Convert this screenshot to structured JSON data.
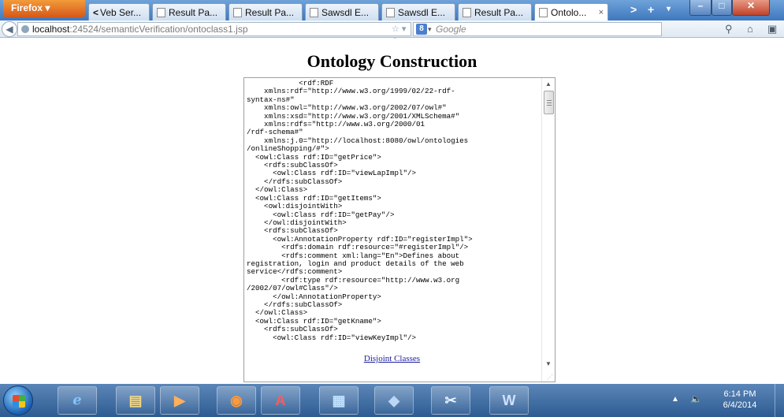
{
  "browser": {
    "menu_button": "Firefox ▾",
    "tabs": [
      {
        "label": "Veb Ser..."
      },
      {
        "label": "Result Pa..."
      },
      {
        "label": "Result Pa..."
      },
      {
        "label": "Sawsdl E..."
      },
      {
        "label": "Sawsdl E..."
      },
      {
        "label": "Result Pa..."
      },
      {
        "label": "Ontolo...",
        "active": true
      }
    ],
    "active_tab_close": "×",
    "new_tab": "+",
    "tab_scroll": ">",
    "tab_list": "▾",
    "url": {
      "host": "localhost",
      "rest": ":24524/semanticVerification/ontoclass1.jsp"
    },
    "search_placeholder": "Google",
    "search_engine_icon": "google-icon"
  },
  "page": {
    "title": "Ontology Construction",
    "textarea_content": "            <rdf:RDF\n    xmlns:rdf=\"http://www.w3.org/1999/02/22-rdf-\nsyntax-ns#\"\n    xmlns:owl=\"http://www.w3.org/2002/07/owl#\"\n    xmlns:xsd=\"http://www.w3.org/2001/XMLSchema#\"\n    xmlns:rdfs=\"http://www.w3.org/2000/01\n/rdf-schema#\"\n    xmlns:j.0=\"http://localhost:8080/owl/ontologies\n/onlineShopping/#\">\n  <owl:Class rdf:ID=\"getPrice\">\n    <rdfs:subClassOf>\n      <owl:Class rdf:ID=\"viewLapImpl\"/>\n    </rdfs:subClassOf>\n  </owl:Class>\n  <owl:Class rdf:ID=\"getItems\">\n    <owl:disjointWith>\n      <owl:Class rdf:ID=\"getPay\"/>\n    </owl:disjointWith>\n    <rdfs:subClassOf>\n      <owl:AnnotationProperty rdf:ID=\"registerImpl\">\n        <rdfs:domain rdf:resource=\"#registerImpl\"/>\n        <rdfs:comment xml:lang=\"En\">Defines about\nregistration, login and product details of the web\nservice</rdfs:comment>\n        <rdf:type rdf:resource=\"http://www.w3.org\n/2002/07/owl#Class\"/>\n      </owl:AnnotationProperty>\n    </rdfs:subClassOf>\n  </owl:Class>\n  <owl:Class rdf:ID=\"getKname\">\n    <rdfs:subClassOf>\n      <owl:Class rdf:ID=\"viewKeyImpl\"/>",
    "link_label": "Disjoint Classes"
  },
  "taskbar": {
    "apps": [
      {
        "name": "internet-explorer",
        "glyph": "e"
      },
      {
        "name": "file-explorer",
        "glyph": "▤"
      },
      {
        "name": "media-player",
        "glyph": "▶"
      },
      {
        "name": "firefox",
        "glyph": "◉"
      },
      {
        "name": "acrobat",
        "glyph": "A"
      },
      {
        "name": "control-panel",
        "glyph": "▦"
      },
      {
        "name": "virtualbox",
        "glyph": "◆"
      },
      {
        "name": "snipping-tool",
        "glyph": "✂"
      },
      {
        "name": "word",
        "glyph": "W"
      }
    ],
    "time": "6:14 PM",
    "date": "6/4/2014"
  },
  "colors": {
    "firefox_orange": "#e06a22",
    "titlebar_blue": "#4f86c8",
    "link_blue": "#1b1ba0",
    "taskbar_blue": "#2d5b92"
  }
}
